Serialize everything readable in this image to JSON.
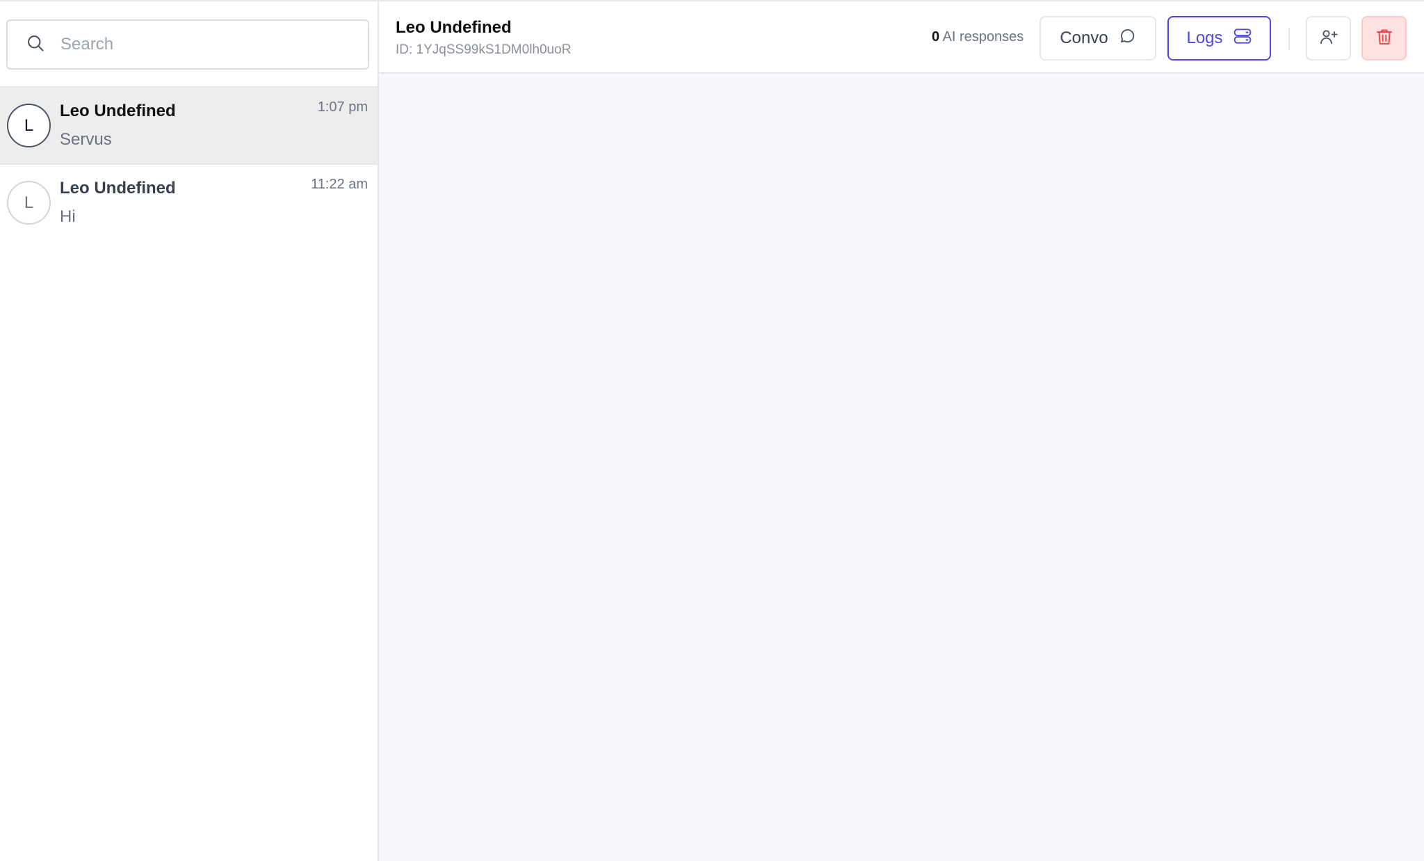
{
  "search": {
    "placeholder": "Search",
    "value": ""
  },
  "conversations": [
    {
      "avatar_initial": "L",
      "name": "Leo Undefined",
      "preview": "Servus",
      "time": "1:07 pm",
      "active": true
    },
    {
      "avatar_initial": "L",
      "name": "Leo Undefined",
      "preview": "Hi",
      "time": "11:22 am",
      "active": false
    }
  ],
  "header": {
    "contact_name": "Leo Undefined",
    "contact_id": "ID: 1YJqSS99kS1DM0lh0uoR",
    "ai_count": "0",
    "ai_label": "AI responses",
    "convo_label": "Convo",
    "logs_label": "Logs"
  },
  "icons": {
    "search": "search-icon",
    "convo": "chat-bubble-icon",
    "logs": "database-icon",
    "add_user": "user-plus-icon",
    "delete": "trash-icon"
  },
  "colors": {
    "accent": "#4f46e5",
    "danger": "#ef4444",
    "danger_bg": "#fee2e2",
    "active_row": "#ededed",
    "content_bg": "#f7f8fb"
  }
}
